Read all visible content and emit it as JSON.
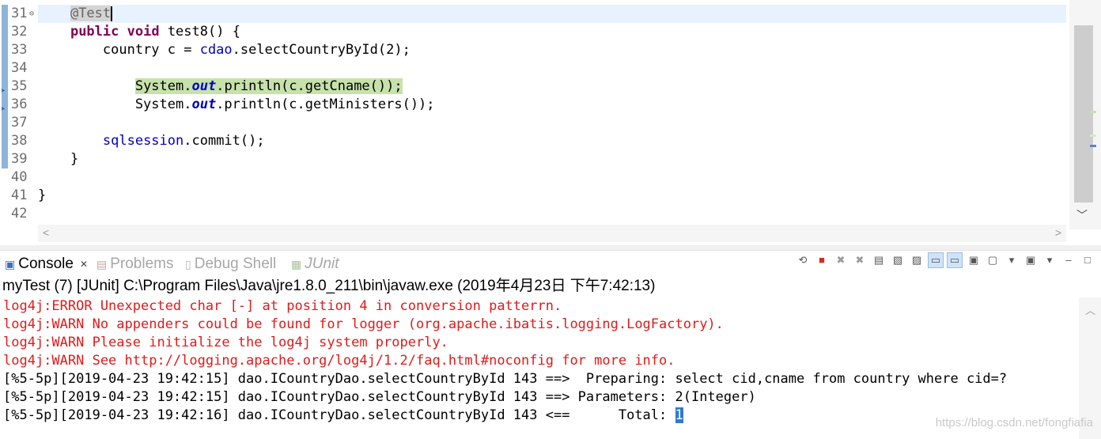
{
  "editor": {
    "line_numbers": [
      "31",
      "32",
      "33",
      "34",
      "35",
      "36",
      "37",
      "38",
      "39",
      "40",
      "41",
      "42"
    ],
    "lines": [
      {
        "parts": [
          {
            "t": "    ",
            "c": ""
          },
          {
            "t": "@Test",
            "c": "ann"
          }
        ]
      },
      {
        "parts": [
          {
            "t": "    ",
            "c": ""
          },
          {
            "t": "public",
            "c": "kw"
          },
          {
            "t": " ",
            "c": ""
          },
          {
            "t": "void",
            "c": "kw"
          },
          {
            "t": " test8() {",
            "c": ""
          }
        ]
      },
      {
        "parts": [
          {
            "t": "        country c = ",
            "c": ""
          },
          {
            "t": "cdao",
            "c": "field"
          },
          {
            "t": ".selectCountryById(2);",
            "c": ""
          }
        ]
      },
      {
        "parts": [
          {
            "t": "",
            "c": ""
          }
        ]
      },
      {
        "parts": [
          {
            "t": "            ",
            "c": ""
          },
          {
            "t": "System.",
            "c": "debug"
          },
          {
            "t": "out",
            "c": "debug sfield"
          },
          {
            "t": ".println(c.getCname());",
            "c": "debug"
          }
        ]
      },
      {
        "parts": [
          {
            "t": "            System.",
            "c": ""
          },
          {
            "t": "out",
            "c": "sfield"
          },
          {
            "t": ".println(c.getMinisters());",
            "c": ""
          }
        ]
      },
      {
        "parts": [
          {
            "t": "",
            "c": ""
          }
        ]
      },
      {
        "parts": [
          {
            "t": "        ",
            "c": ""
          },
          {
            "t": "sqlsession",
            "c": "field"
          },
          {
            "t": ".commit();",
            "c": ""
          }
        ]
      },
      {
        "parts": [
          {
            "t": "    }",
            "c": ""
          }
        ]
      },
      {
        "parts": [
          {
            "t": "",
            "c": ""
          }
        ]
      },
      {
        "parts": [
          {
            "t": "}",
            "c": ""
          }
        ]
      },
      {
        "parts": [
          {
            "t": "",
            "c": ""
          }
        ]
      }
    ]
  },
  "tabs": [
    {
      "label": "Console",
      "icon": "console-icon",
      "active": true
    },
    {
      "label": "Problems",
      "icon": "problems-icon",
      "active": false
    },
    {
      "label": "Debug Shell",
      "icon": "debug-shell-icon",
      "active": false
    },
    {
      "label": "JUnit",
      "icon": "junit-icon",
      "active": false
    }
  ],
  "toolbar_icons": [
    "remove-launch-icon",
    "terminate-icon",
    "remove-all-terminated-icon",
    "remove-all-icon",
    "scroll-lock-icon",
    "word-wrap-icon",
    "pin-console-icon",
    "show-stdout-icon",
    "show-stderr-icon",
    "open-console-icon",
    "display-console-icon",
    "display-dropdown-icon",
    "new-console-icon",
    "new-console-dropdown-icon",
    "minimize-icon",
    "maximize-icon"
  ],
  "process_label": "myTest (7) [JUnit] C:\\Program Files\\Java\\jre1.8.0_211\\bin\\javaw.exe (2019年4月23日 下午7:42:13)",
  "console": {
    "lines": [
      {
        "text": "log4j:ERROR Unexpected char [-] at position 4 in conversion patterrn.",
        "type": "err"
      },
      {
        "text": "log4j:WARN No appenders could be found for logger (org.apache.ibatis.logging.LogFactory).",
        "type": "err"
      },
      {
        "text": "log4j:WARN Please initialize the log4j system properly.",
        "type": "err"
      },
      {
        "text": "log4j:WARN See http://logging.apache.org/log4j/1.2/faq.html#noconfig for more info.",
        "type": "err"
      },
      {
        "text": "[%5-5p][2019-04-23 19:42:15] dao.ICountryDao.selectCountryById 143 ==>  Preparing: select cid,cname from country where cid=?",
        "type": "out"
      },
      {
        "text": "[%5-5p][2019-04-23 19:42:15] dao.ICountryDao.selectCountryById 143 ==> Parameters: 2(Integer)",
        "type": "out"
      },
      {
        "text": "[%5-5p][2019-04-23 19:42:16] dao.ICountryDao.selectCountryById 143 <==      Total: ",
        "type": "out",
        "selected": "1"
      }
    ]
  },
  "watermark": "https://blog.csdn.net/fongfiafia"
}
